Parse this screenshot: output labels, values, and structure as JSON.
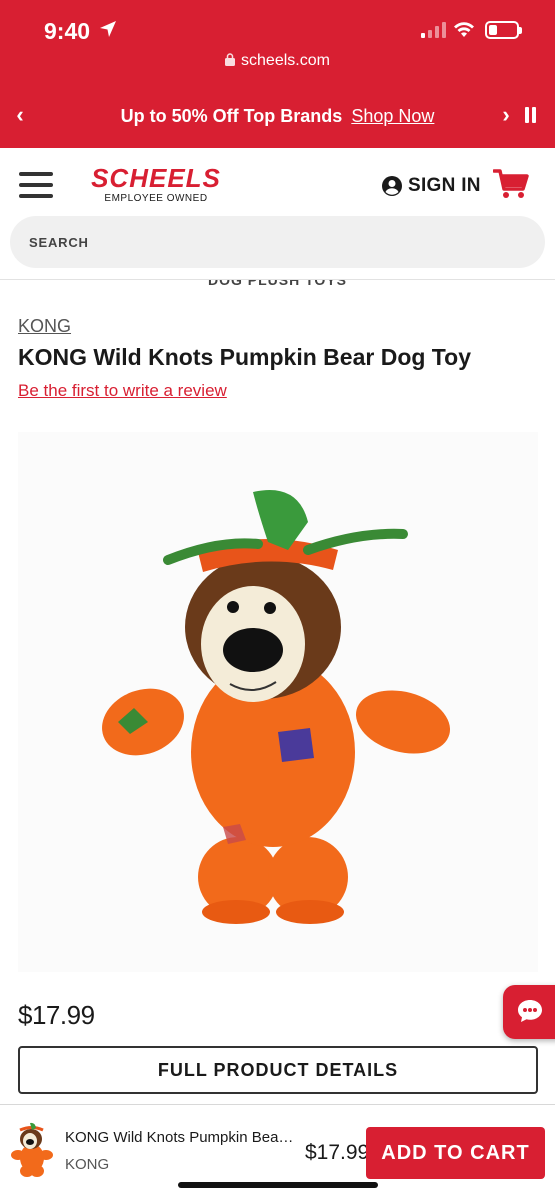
{
  "status_bar": {
    "time": "9:40",
    "battery_level": 0.3
  },
  "browser": {
    "url": "scheels.com"
  },
  "promo": {
    "text": "Up to 50% Off Top Brands",
    "link": "Shop Now"
  },
  "header": {
    "logo": "SCHEELS",
    "logo_sub": "EMPLOYEE OWNED",
    "signin": "SIGN IN",
    "search_placeholder": "SEARCH"
  },
  "breadcrumb": "DOG PLUSH TOYS",
  "product": {
    "brand": "KONG",
    "title": "KONG Wild Knots Pumpkin Bear Dog Toy",
    "review_link": "Be the first to write a review",
    "price": "$17.99",
    "details_button": "FULL PRODUCT DETAILS"
  },
  "sticky": {
    "name": "KONG Wild Knots Pumpkin Bear Dog Toy",
    "brand": "KONG",
    "price": "$17.99",
    "add_to_cart": "ADD TO CART"
  },
  "colors": {
    "brand_red": "#d81f32",
    "toy_orange": "#f26a1b",
    "hat_green": "#3a9a3c"
  }
}
